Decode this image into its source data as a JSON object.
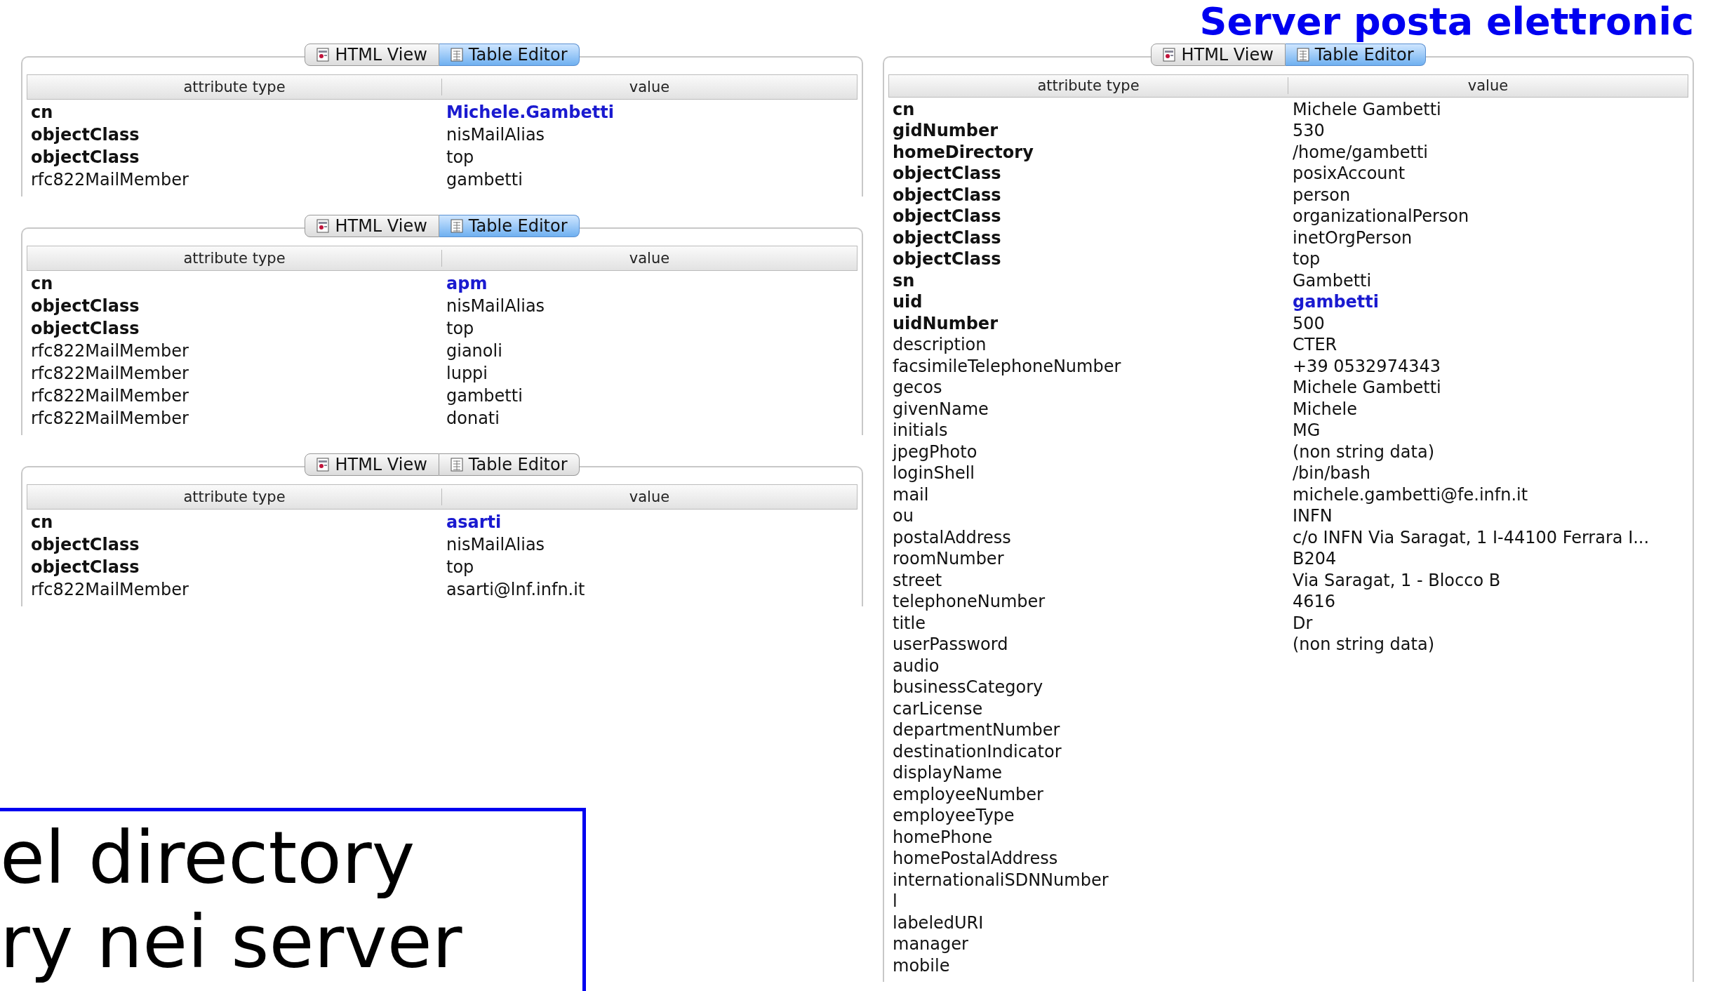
{
  "slide_title": "Server posta elettronic",
  "panels": [
    {
      "tabs": [
        {
          "label": "HTML View",
          "kind": "html",
          "selected": false
        },
        {
          "label": "Table Editor",
          "kind": "table",
          "selected": true
        }
      ],
      "columns": [
        "attribute type",
        "value"
      ],
      "rows": [
        {
          "attribute": "cn",
          "value": "Michele.Gambetti",
          "required": true,
          "naming": true
        },
        {
          "attribute": "objectClass",
          "value": "nisMailAlias",
          "required": true,
          "naming": false
        },
        {
          "attribute": "objectClass",
          "value": "top",
          "required": true,
          "naming": false
        },
        {
          "attribute": "rfc822MailMember",
          "value": "gambetti",
          "required": false,
          "naming": false
        }
      ]
    },
    {
      "tabs": [
        {
          "label": "HTML View",
          "kind": "html",
          "selected": false
        },
        {
          "label": "Table Editor",
          "kind": "table",
          "selected": true
        }
      ],
      "columns": [
        "attribute type",
        "value"
      ],
      "rows": [
        {
          "attribute": "cn",
          "value": "apm",
          "required": true,
          "naming": true
        },
        {
          "attribute": "objectClass",
          "value": "nisMailAlias",
          "required": true,
          "naming": false
        },
        {
          "attribute": "objectClass",
          "value": "top",
          "required": true,
          "naming": false
        },
        {
          "attribute": "rfc822MailMember",
          "value": "gianoli",
          "required": false,
          "naming": false
        },
        {
          "attribute": "rfc822MailMember",
          "value": "luppi",
          "required": false,
          "naming": false
        },
        {
          "attribute": "rfc822MailMember",
          "value": "gambetti",
          "required": false,
          "naming": false
        },
        {
          "attribute": "rfc822MailMember",
          "value": "donati",
          "required": false,
          "naming": false
        }
      ]
    },
    {
      "tabs": [
        {
          "label": "HTML View",
          "kind": "html",
          "selected": false
        },
        {
          "label": "Table Editor",
          "kind": "table",
          "selected": false
        }
      ],
      "columns": [
        "attribute type",
        "value"
      ],
      "rows": [
        {
          "attribute": "cn",
          "value": "asarti",
          "required": true,
          "naming": true
        },
        {
          "attribute": "objectClass",
          "value": "nisMailAlias",
          "required": true,
          "naming": false
        },
        {
          "attribute": "objectClass",
          "value": "top",
          "required": true,
          "naming": false
        },
        {
          "attribute": "rfc822MailMember",
          "value": "asarti@lnf.infn.it",
          "required": false,
          "naming": false
        }
      ]
    }
  ],
  "note_lines": [
    "el directory",
    "ry nei server"
  ],
  "entry_panel": {
    "tabs": [
      {
        "label": "HTML View",
        "kind": "html",
        "selected": false
      },
      {
        "label": "Table Editor",
        "kind": "table",
        "selected": true
      }
    ],
    "columns": [
      "attribute type",
      "value"
    ],
    "rows": [
      {
        "attribute": "cn",
        "value": "Michele Gambetti",
        "required": true,
        "naming": false
      },
      {
        "attribute": "gidNumber",
        "value": "530",
        "required": true,
        "naming": false
      },
      {
        "attribute": "homeDirectory",
        "value": "/home/gambetti",
        "required": true,
        "naming": false
      },
      {
        "attribute": "objectClass",
        "value": "posixAccount",
        "required": true,
        "naming": false
      },
      {
        "attribute": "objectClass",
        "value": "person",
        "required": true,
        "naming": false
      },
      {
        "attribute": "objectClass",
        "value": "organizationalPerson",
        "required": true,
        "naming": false
      },
      {
        "attribute": "objectClass",
        "value": "inetOrgPerson",
        "required": true,
        "naming": false
      },
      {
        "attribute": "objectClass",
        "value": "top",
        "required": true,
        "naming": false
      },
      {
        "attribute": "sn",
        "value": "Gambetti",
        "required": true,
        "naming": false
      },
      {
        "attribute": "uid",
        "value": "gambetti",
        "required": true,
        "naming": true
      },
      {
        "attribute": "uidNumber",
        "value": "500",
        "required": true,
        "naming": false
      },
      {
        "attribute": "description",
        "value": "CTER",
        "required": false,
        "naming": false
      },
      {
        "attribute": "facsimileTelephoneNumber",
        "value": "+39 0532974343",
        "required": false,
        "naming": false
      },
      {
        "attribute": "gecos",
        "value": "Michele Gambetti",
        "required": false,
        "naming": false
      },
      {
        "attribute": "givenName",
        "value": "Michele",
        "required": false,
        "naming": false
      },
      {
        "attribute": "initials",
        "value": "MG",
        "required": false,
        "naming": false
      },
      {
        "attribute": "jpegPhoto",
        "value": "(non string data)",
        "required": false,
        "naming": false
      },
      {
        "attribute": "loginShell",
        "value": "/bin/bash",
        "required": false,
        "naming": false
      },
      {
        "attribute": "mail",
        "value": "michele.gambetti@fe.infn.it",
        "required": false,
        "naming": false
      },
      {
        "attribute": "ou",
        "value": "INFN",
        "required": false,
        "naming": false
      },
      {
        "attribute": "postalAddress",
        "value": "c/o INFN Via Saragat, 1  I-44100 Ferrara   I...",
        "required": false,
        "naming": false
      },
      {
        "attribute": "roomNumber",
        "value": "B204",
        "required": false,
        "naming": false
      },
      {
        "attribute": "street",
        "value": "Via Saragat, 1 - Blocco B",
        "required": false,
        "naming": false
      },
      {
        "attribute": "telephoneNumber",
        "value": "4616",
        "required": false,
        "naming": false
      },
      {
        "attribute": "title",
        "value": "Dr",
        "required": false,
        "naming": false
      },
      {
        "attribute": "userPassword",
        "value": "(non string data)",
        "required": false,
        "naming": false
      },
      {
        "attribute": "audio",
        "required": false
      },
      {
        "attribute": "businessCategory",
        "required": false
      },
      {
        "attribute": "carLicense",
        "required": false
      },
      {
        "attribute": "departmentNumber",
        "required": false
      },
      {
        "attribute": "destinationIndicator",
        "required": false
      },
      {
        "attribute": "displayName",
        "required": false
      },
      {
        "attribute": "employeeNumber",
        "required": false
      },
      {
        "attribute": "employeeType",
        "required": false
      },
      {
        "attribute": "homePhone",
        "required": false
      },
      {
        "attribute": "homePostalAddress",
        "required": false
      },
      {
        "attribute": "internationaliSDNNumber",
        "required": false
      },
      {
        "attribute": "l",
        "required": false
      },
      {
        "attribute": "labeledURI",
        "required": false
      },
      {
        "attribute": "manager",
        "required": false
      },
      {
        "attribute": "mobile",
        "required": false
      }
    ]
  }
}
